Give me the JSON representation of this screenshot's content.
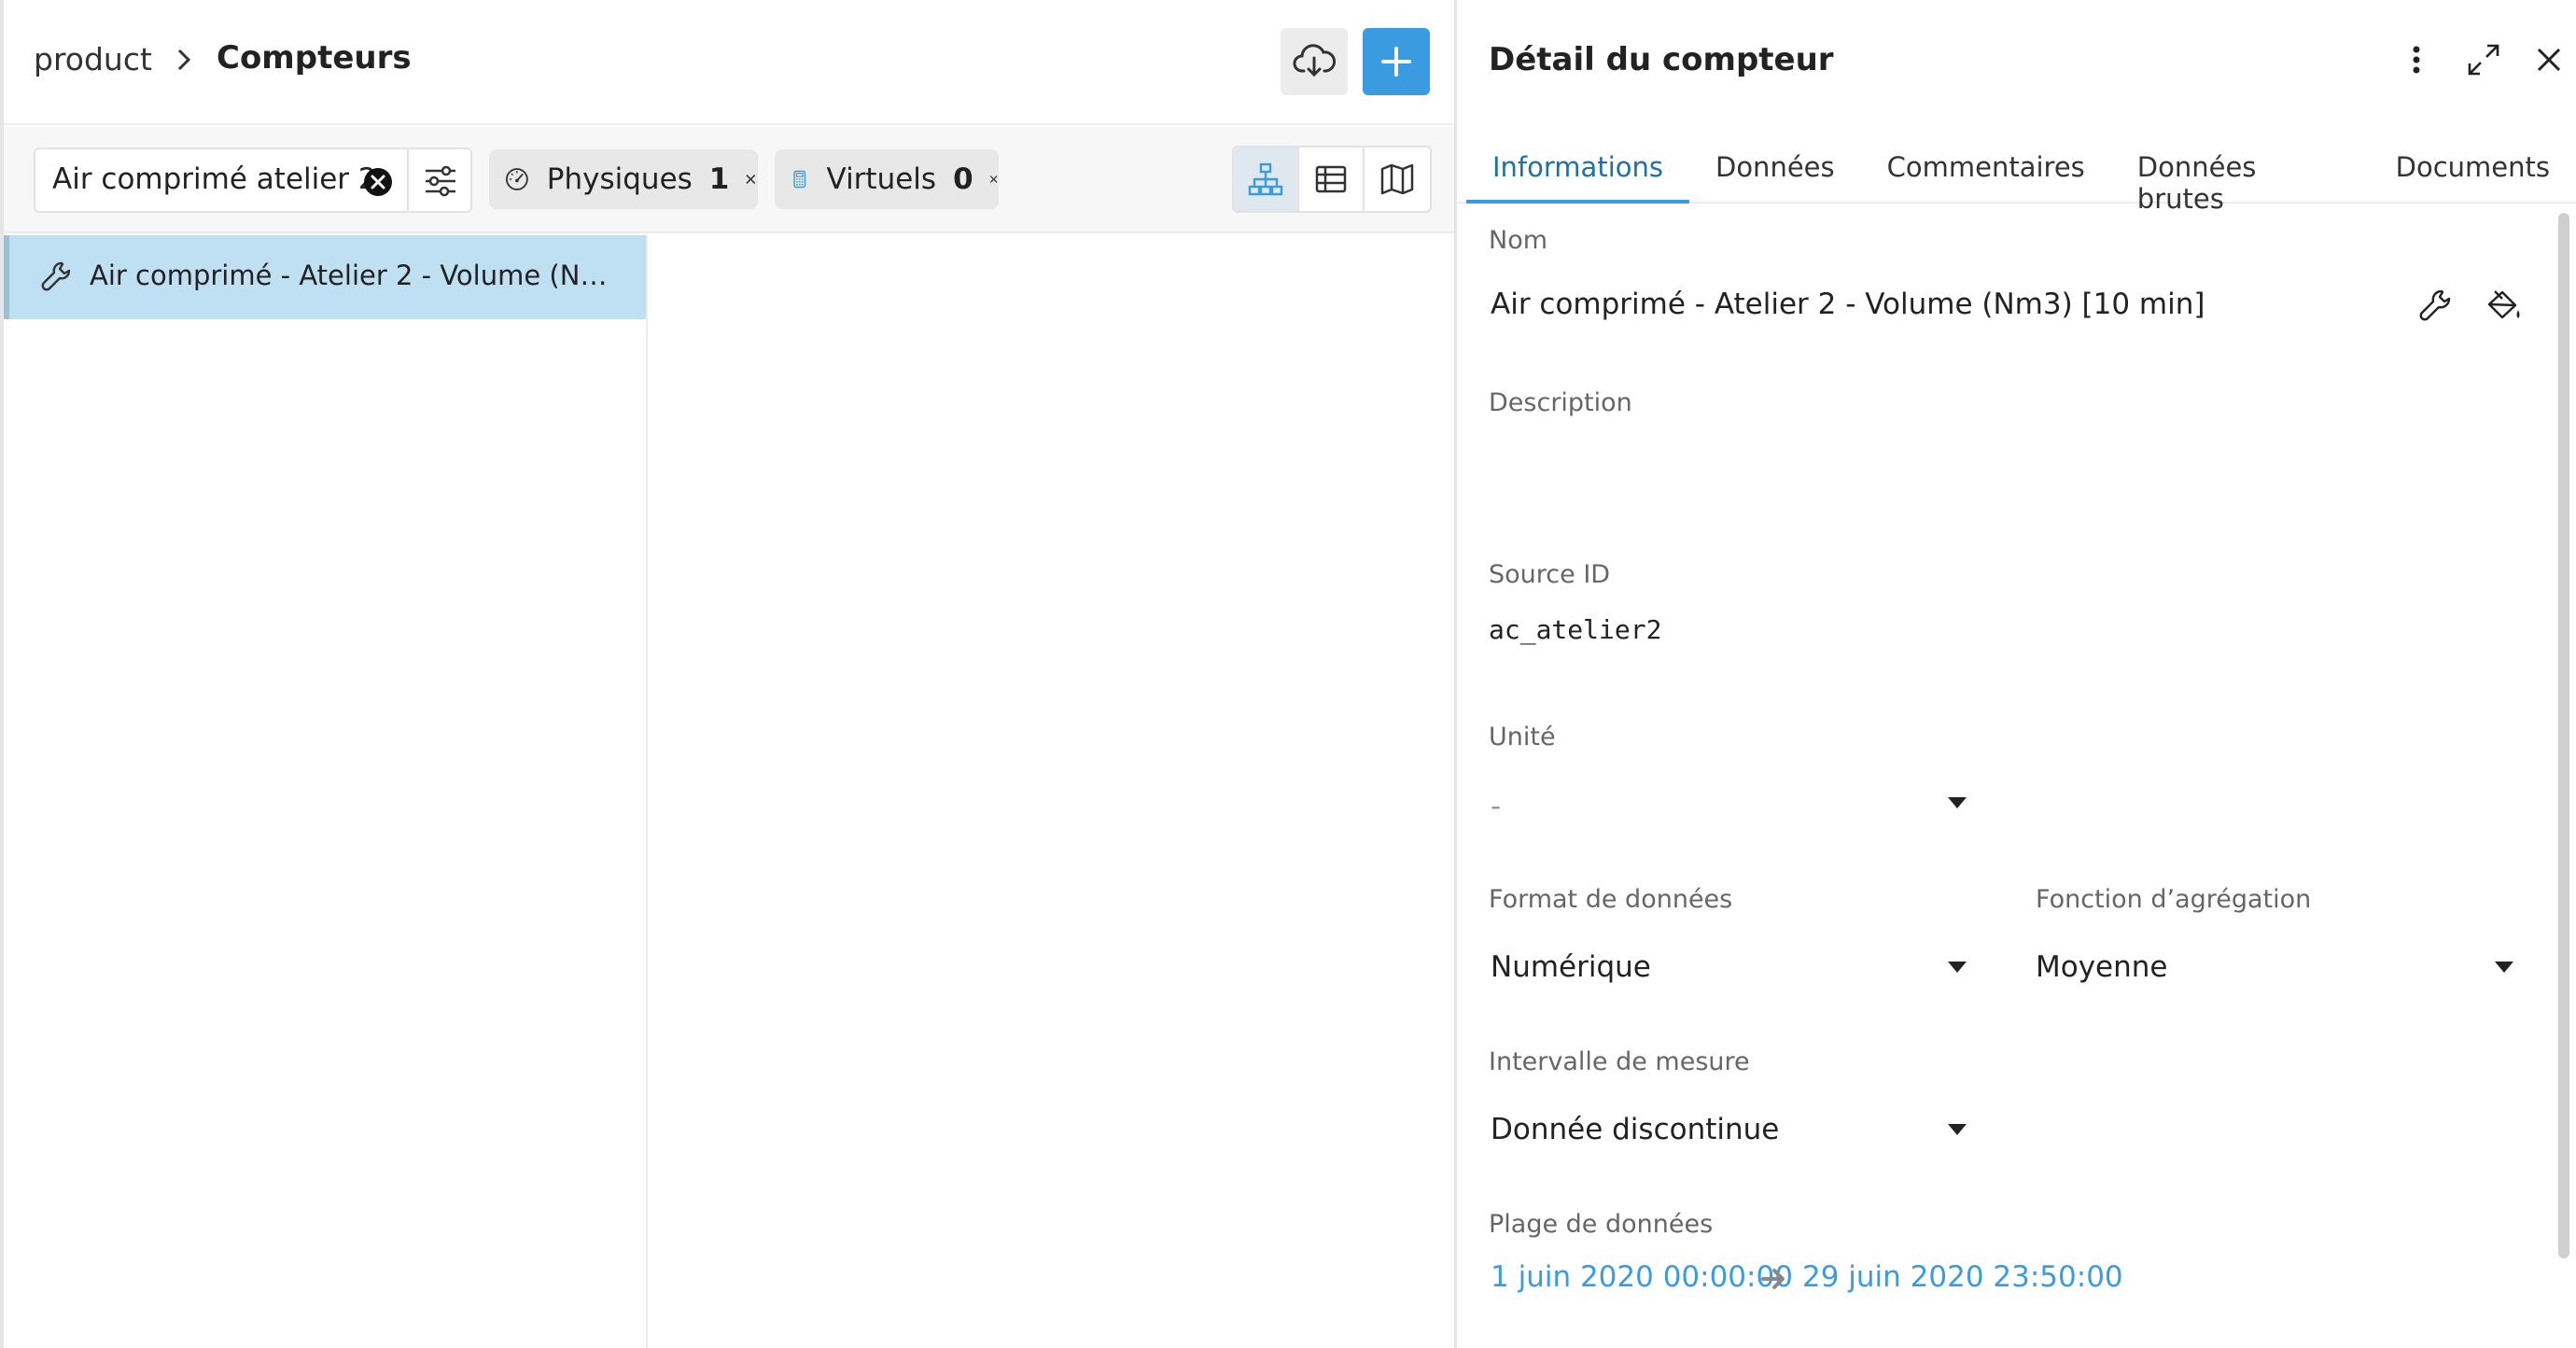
{
  "breadcrumb": {
    "root": "product",
    "current": "Compteurs"
  },
  "toolbar": {
    "download_icon": "cloud-download-icon",
    "add_icon": "plus-icon"
  },
  "search": {
    "value": "Air comprimé atelier 2"
  },
  "chips": [
    {
      "label": "Physiques",
      "count": "1",
      "icon": "gauge-icon"
    },
    {
      "label": "Virtuels",
      "count": "0",
      "icon": "calculator-icon"
    }
  ],
  "views": [
    "tree-view-icon",
    "table-view-icon",
    "map-view-icon"
  ],
  "tree": {
    "selected_label": "Air comprimé - Atelier 2 - Volume (Nm3) [10 min]"
  },
  "panel": {
    "title": "Détail du compteur",
    "tabs": [
      "Informations",
      "Données",
      "Commentaires",
      "Données brutes",
      "Documents"
    ],
    "active_tab": "Informations",
    "fields": {
      "nom_label": "Nom",
      "nom_value": "Air comprimé - Atelier 2 - Volume (Nm3) [10 min]",
      "description_label": "Description",
      "source_label": "Source ID",
      "source_value": "ac_atelier2",
      "unite_label": "Unité",
      "unite_value": "-",
      "format_label": "Format de données",
      "format_value": "Numérique",
      "agg_label": "Fonction d’agrégation",
      "agg_value": "Moyenne",
      "interval_label": "Intervalle de mesure",
      "interval_value": "Donnée discontinue",
      "range_label": "Plage de données",
      "range_start": "1 juin 2020 00:00:00",
      "range_end": "29 juin 2020 23:50:00"
    }
  },
  "colors": {
    "accent": "#3a9be0",
    "selected_row": "#bfe0f3"
  }
}
